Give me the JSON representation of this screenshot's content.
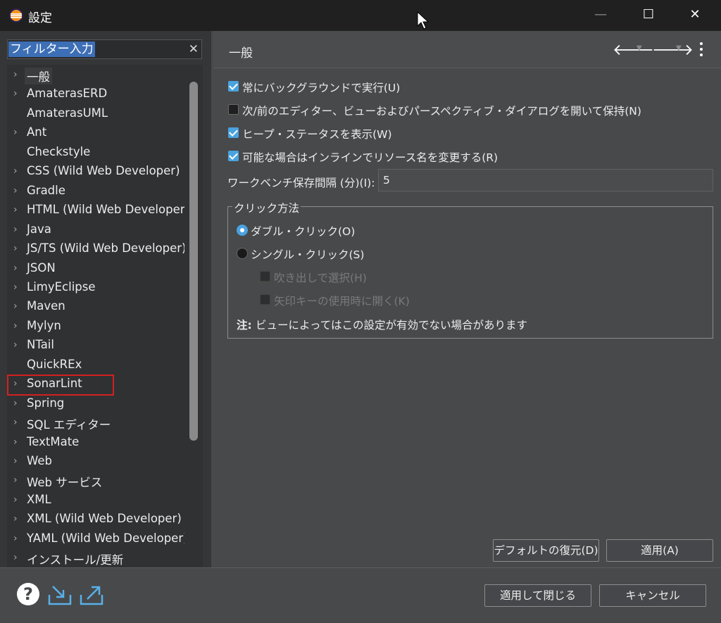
{
  "window": {
    "title": "設定",
    "controls": {
      "minimize": "—",
      "maximize": "☐",
      "close": "✕"
    }
  },
  "sidebar": {
    "filter": {
      "text": "フィルター入力",
      "clear": "✕"
    },
    "items": [
      {
        "label": "一般",
        "expandable": true,
        "selected": true
      },
      {
        "label": "AmaterasERD",
        "expandable": true
      },
      {
        "label": "AmaterasUML",
        "expandable": false
      },
      {
        "label": "Ant",
        "expandable": true
      },
      {
        "label": "Checkstyle",
        "expandable": false
      },
      {
        "label": "CSS (Wild Web Developer)",
        "expandable": true
      },
      {
        "label": "Gradle",
        "expandable": true
      },
      {
        "label": "HTML (Wild Web Developer)",
        "expandable": true
      },
      {
        "label": "Java",
        "expandable": true
      },
      {
        "label": "JS/TS (Wild Web Developer)",
        "expandable": true
      },
      {
        "label": "JSON",
        "expandable": true
      },
      {
        "label": "LimyEclipse",
        "expandable": true
      },
      {
        "label": "Maven",
        "expandable": true
      },
      {
        "label": "Mylyn",
        "expandable": true
      },
      {
        "label": "NTail",
        "expandable": true
      },
      {
        "label": "QuickREx",
        "expandable": false
      },
      {
        "label": "SonarLint",
        "expandable": true
      },
      {
        "label": "Spring",
        "expandable": true
      },
      {
        "label": "SQL エディター",
        "expandable": true
      },
      {
        "label": "TextMate",
        "expandable": true
      },
      {
        "label": "Web",
        "expandable": true
      },
      {
        "label": "Web サービス",
        "expandable": true
      },
      {
        "label": "XML",
        "expandable": true
      },
      {
        "label": "XML (Wild Web Developer)",
        "expandable": true
      },
      {
        "label": "YAML (Wild Web Developer)",
        "expandable": true
      },
      {
        "label": "インストール/更新",
        "expandable": true
      }
    ]
  },
  "page": {
    "title": "一般",
    "options": [
      {
        "label": "常にバックグラウンドで実行(U)",
        "checked": true
      },
      {
        "label": "次/前のエディター、ビューおよびパースペクティブ・ダイアログを開いて保持(N)",
        "checked": false
      },
      {
        "label": "ヒープ・ステータスを表示(W)",
        "checked": true
      },
      {
        "label": "可能な場合はインラインでリソース名を変更する(R)",
        "checked": true
      }
    ],
    "interval": {
      "label": "ワークベンチ保存間隔 (分)(I):",
      "value": "5"
    },
    "click_group": {
      "title": "クリック方法",
      "double_click": "ダブル・クリック(O)",
      "single_click": "シングル・クリック(S)",
      "selected": "double_click",
      "sub_options": [
        {
          "label": "吹き出しで選択(H)",
          "enabled": false
        },
        {
          "label": "矢印キーの使用時に開く(K)",
          "enabled": false
        }
      ],
      "note_prefix": "注:",
      "note_text": "ビューによってはこの設定が有効でない場合があります"
    },
    "buttons": {
      "restore": "デフォルトの復元(D)",
      "apply": "適用(A)"
    }
  },
  "footer": {
    "help": "?",
    "apply_close": "適用して閉じる",
    "cancel": "キャンセル"
  },
  "colors": {
    "accent": "#4aa3df",
    "highlight_box": "#d42020",
    "selection": "#3d6fb6"
  }
}
